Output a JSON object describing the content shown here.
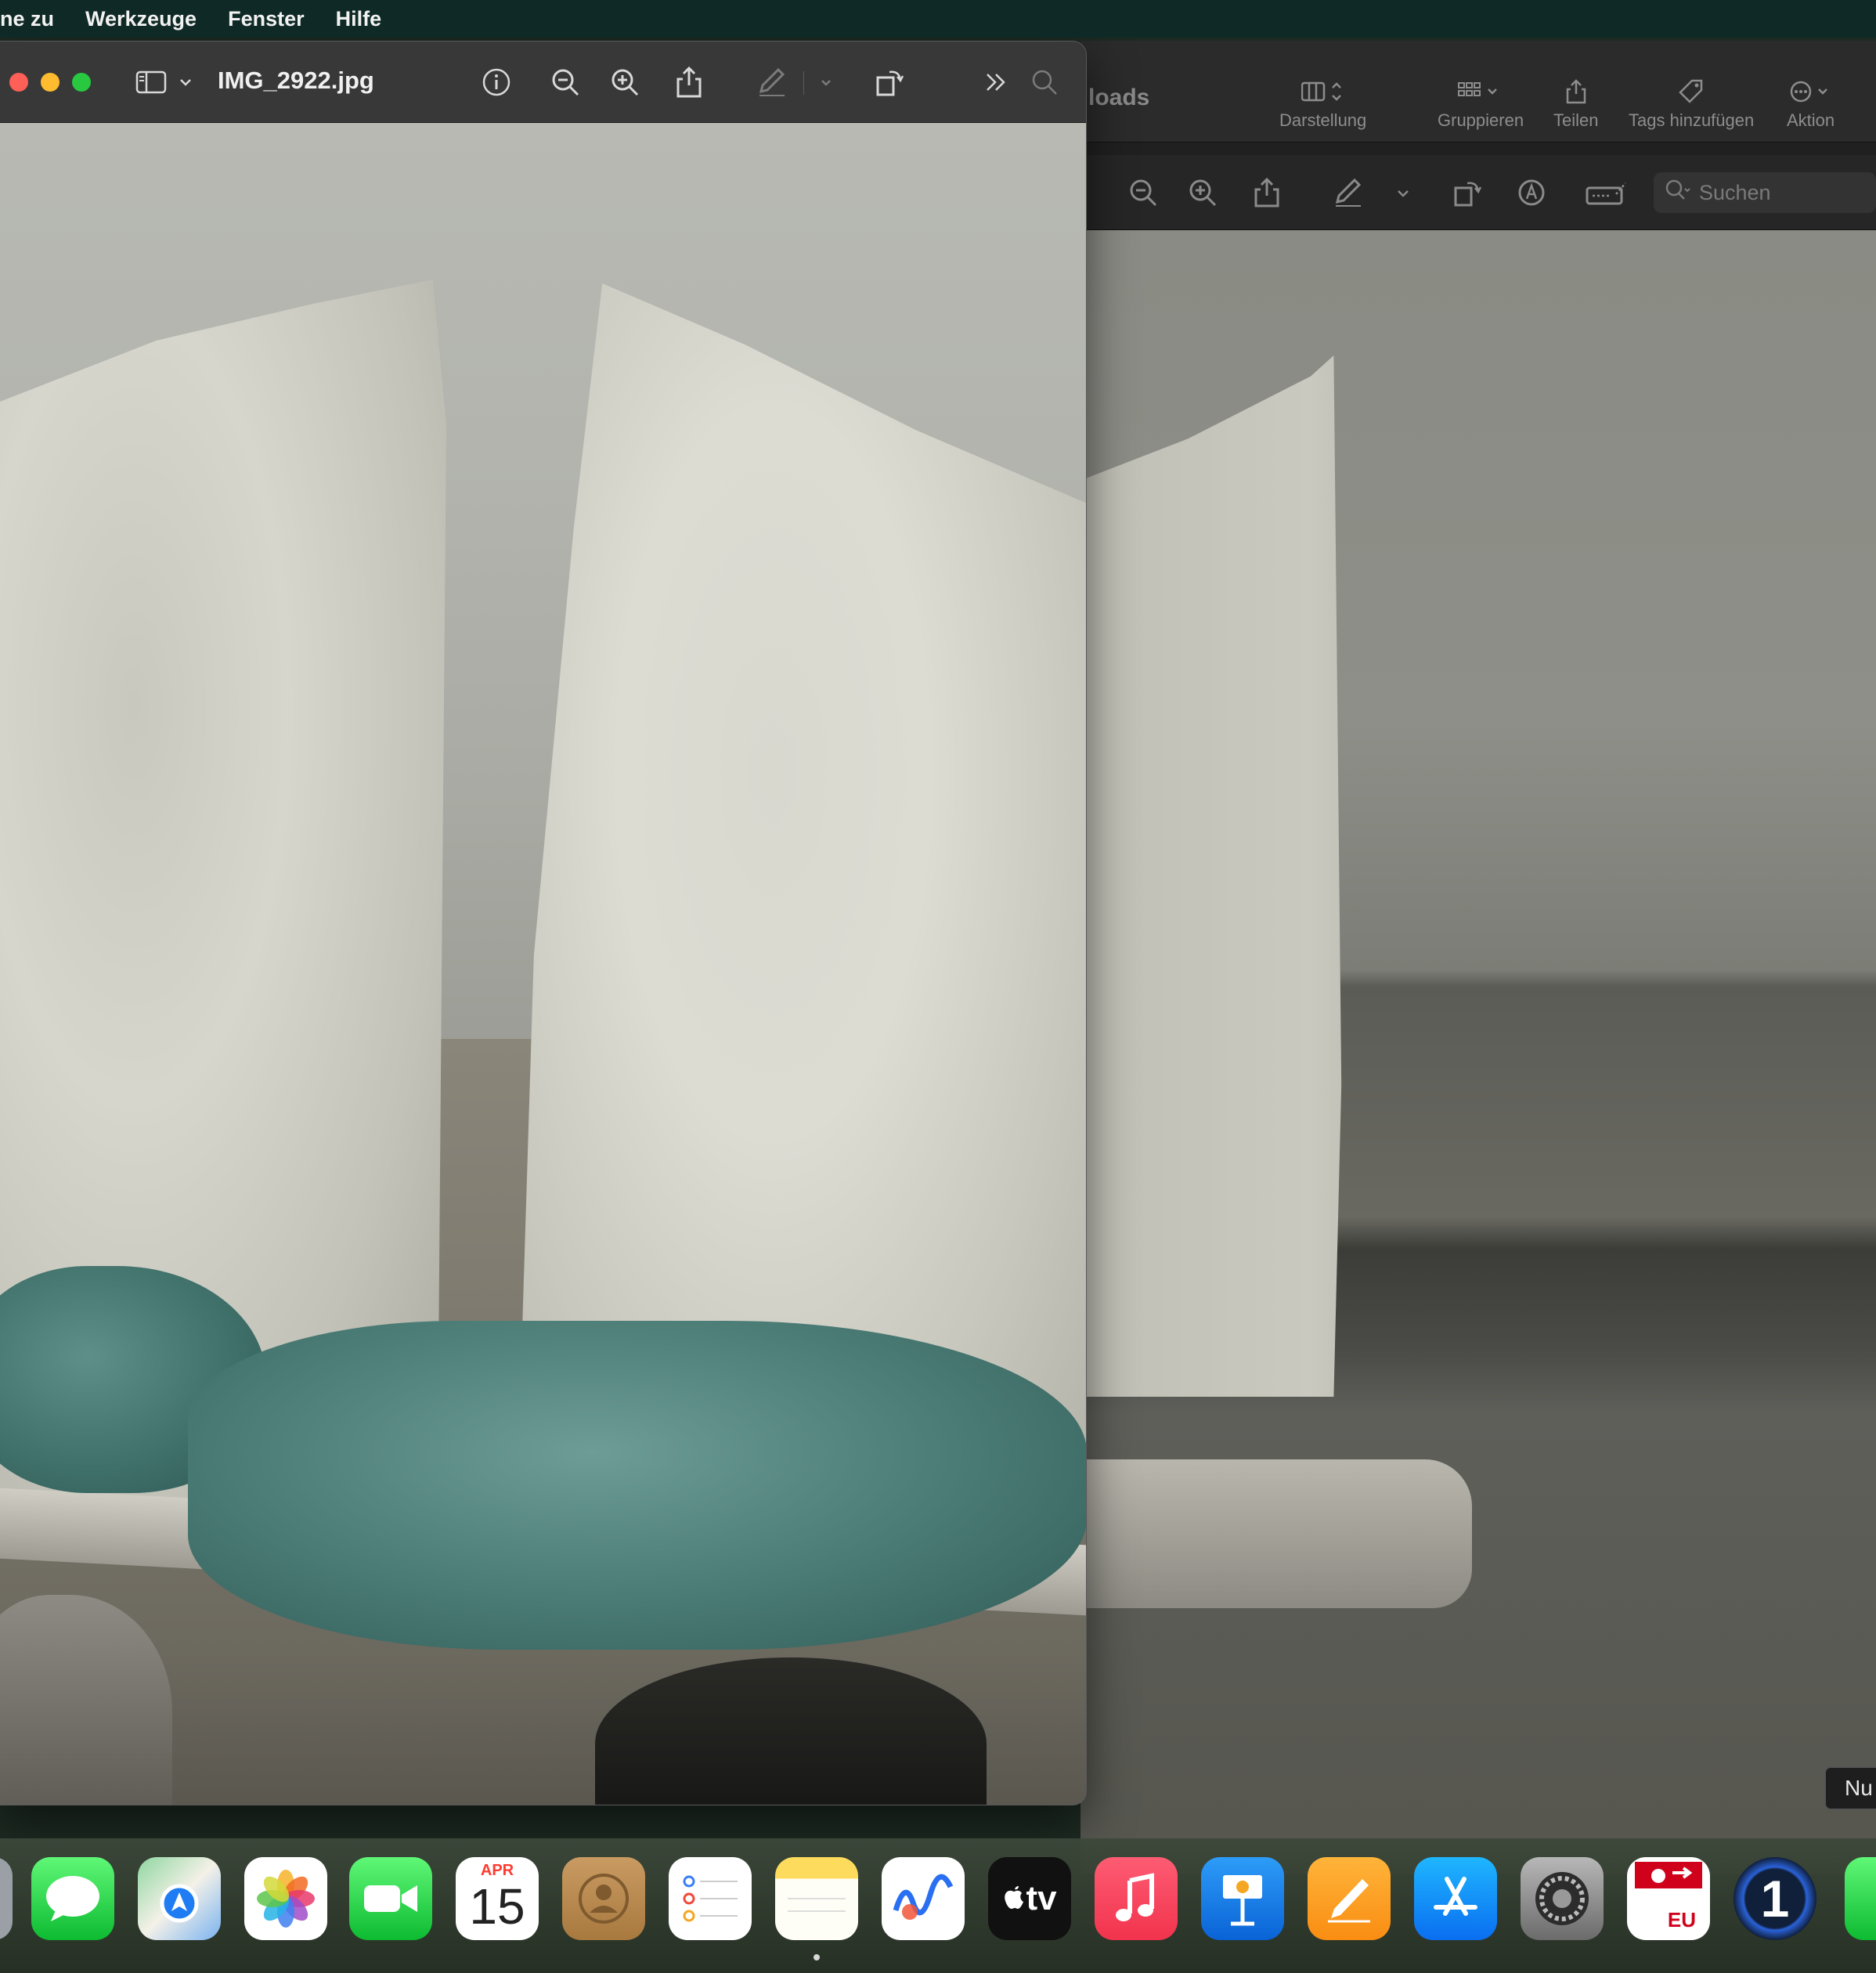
{
  "menubar": {
    "items": [
      "ne zu",
      "Werkzeuge",
      "Fenster",
      "Hilfe"
    ]
  },
  "preview_window": {
    "title": "IMG_2922.jpg",
    "toolbar_icons": [
      "sidebar-icon",
      "chevron-down-icon",
      "info-icon",
      "zoom-out-icon",
      "zoom-in-icon",
      "share-icon",
      "markup-pen-icon",
      "chevron-down-icon",
      "rotate-icon",
      "more-chevrons-icon",
      "search-icon"
    ]
  },
  "finder_window": {
    "title_fragment": "loads",
    "toolbar": {
      "darstellung": "Darstellung",
      "gruppieren": "Gruppieren",
      "teilen": "Teilen",
      "tags": "Tags hinzufügen",
      "aktion": "Aktion"
    },
    "search_placeholder": "Suchen",
    "pill_text": "Nu"
  },
  "dock": {
    "calendar_month": "APR",
    "calendar_day": "15",
    "tv_label": "tv",
    "eu_label": "EU",
    "onepassword_label": "1",
    "apps": [
      "messages",
      "maps",
      "photos",
      "facetime",
      "calendar",
      "contacts",
      "reminders",
      "notes",
      "freeform",
      "apple-tv",
      "music",
      "keynote",
      "pages",
      "app-store",
      "system-settings",
      "eu-app",
      "1password"
    ]
  }
}
